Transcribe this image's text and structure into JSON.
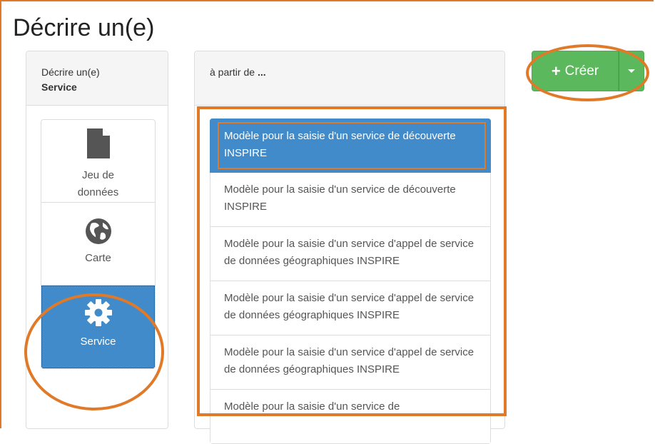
{
  "page": {
    "title": "Décrire un(e)"
  },
  "left_panel": {
    "heading_line1": "Décrire un(e)",
    "heading_line2": "Service",
    "types": [
      {
        "label": "Jeu de\ndonnées",
        "icon": "file-icon",
        "active": false
      },
      {
        "label": "Carte",
        "icon": "globe-icon",
        "active": false
      },
      {
        "label": "Service",
        "icon": "gear-icon",
        "active": true
      }
    ]
  },
  "middle_panel": {
    "heading_prefix": "à partir de ",
    "heading_suffix": "...",
    "templates": [
      {
        "label": "Modèle pour la saisie d'un service de découverte INSPIRE",
        "active": true
      },
      {
        "label": "Modèle pour la saisie d'un service de découverte INSPIRE",
        "active": false
      },
      {
        "label": "Modèle pour la saisie d'un service d'appel de service de données géographiques INSPIRE",
        "active": false
      },
      {
        "label": "Modèle pour la saisie d'un service d'appel de service de données géographiques INSPIRE",
        "active": false
      },
      {
        "label": "Modèle pour la saisie d'un service d'appel de service de données géographiques INSPIRE",
        "active": false
      },
      {
        "label": "Modèle pour la saisie d'un service de",
        "active": false
      }
    ]
  },
  "actions": {
    "create_label": "Créer",
    "create_icon": "plus-icon",
    "toggle_icon": "caret-down-icon"
  },
  "colors": {
    "primary": "#428bca",
    "success": "#5cb85c",
    "annotation": "#e07a28"
  }
}
